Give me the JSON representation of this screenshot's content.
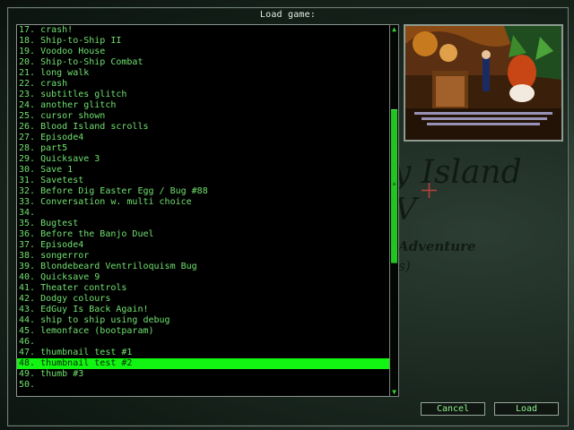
{
  "dialog": {
    "title": "Load game:"
  },
  "saves": [
    "17. crash!",
    "18. Ship-to-Ship II",
    "19. Voodoo House",
    "20. Ship-to-Ship Combat",
    "21. long walk",
    "22. crash",
    "23. subtitles glitch",
    "24. another glitch",
    "25. cursor shown",
    "26. Blood Island scrolls",
    "27. Episode4",
    "28. part5",
    "29. Quicksave 3",
    "30. Save 1",
    "31. Savetest",
    "32. Before Dig Easter Egg / Bug #88",
    "33. Conversation w. multi choice",
    "34.",
    "35. Bugtest",
    "36. Before the Banjo Duel",
    "37. Episode4",
    "38. songerror",
    "39. Blondebeard Ventriloquism Bug",
    "40. Quicksave 9",
    "41. Theater controls",
    "42. Dodgy colours",
    "43. EdGuy Is Back Again!",
    "44. ship to ship using debug",
    "45. lemonface (bootparam)",
    "46.",
    "47. thumbnail test #1",
    "48. thumbnail test #2",
    "49. thumb #3",
    "50."
  ],
  "selected_index": 31,
  "scroll": {
    "position_fraction": 0.5
  },
  "buttons": {
    "cancel": "Cancel",
    "load": "Load"
  },
  "background": {
    "line1": "y Island",
    "line2": "V",
    "line3": "Adventure",
    "line4": "s)"
  },
  "colors": {
    "list_text": "#6fe06f",
    "selection": "#12f512",
    "button_text": "#8ef08e"
  }
}
